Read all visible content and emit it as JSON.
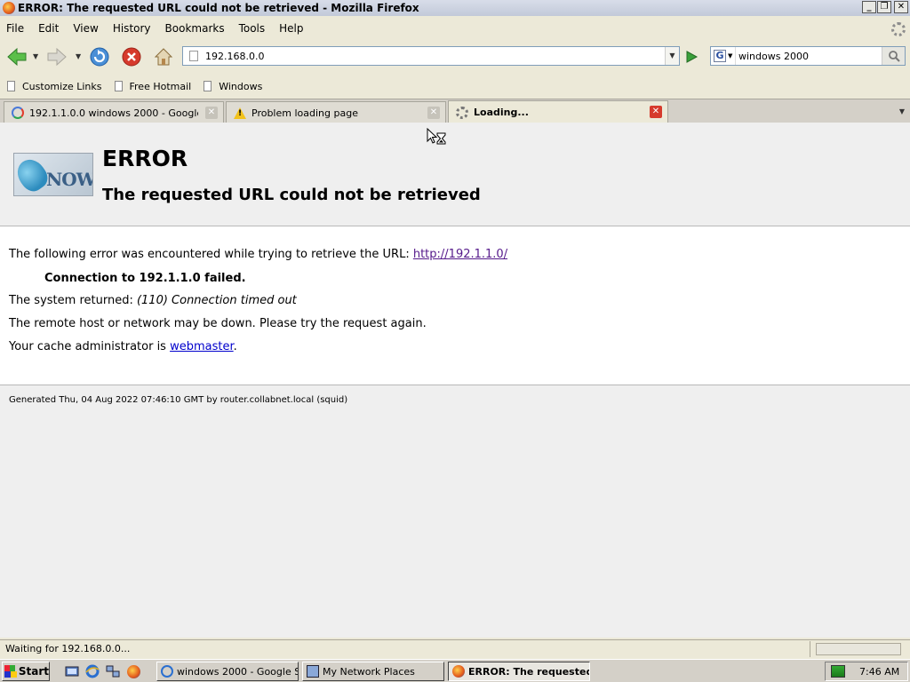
{
  "window": {
    "title": "ERROR: The requested URL could not be retrieved - Mozilla Firefox",
    "minimize": "_",
    "restore": "❐",
    "close": "✕"
  },
  "menu": [
    "File",
    "Edit",
    "View",
    "History",
    "Bookmarks",
    "Tools",
    "Help"
  ],
  "navbar": {
    "url": "192.168.0.0",
    "search_value": "windows 2000",
    "search_engine": "G"
  },
  "bookmarks": [
    "Customize Links",
    "Free Hotmail",
    "Windows"
  ],
  "tabs": [
    {
      "label": "192.1.1.0.0 windows 2000 - Google S...",
      "active": false
    },
    {
      "label": "Problem loading page",
      "active": false
    },
    {
      "label": "Loading...",
      "active": true
    }
  ],
  "page": {
    "logo_text": "NOW",
    "title": "ERROR",
    "subtitle": "The requested URL could not be retrieved",
    "line1_prefix": "The following error was encountered while trying to retrieve the URL: ",
    "line1_link": "http://192.1.1.0/",
    "fail_line": "Connection to 192.1.1.0 failed.",
    "line2_prefix": "The system returned: ",
    "line2_italic": "(110) Connection timed out",
    "line3": "The remote host or network may be down. Please try the request again.",
    "line4_prefix": "Your cache administrator is ",
    "line4_link": "webmaster",
    "line4_suffix": ".",
    "generated": "Generated Thu, 04 Aug 2022 07:46:10 GMT by router.collabnet.local (squid)"
  },
  "status": {
    "text": "Waiting for 192.168.0.0..."
  },
  "taskbar": {
    "start": "Start",
    "tasks": [
      {
        "label": "windows 2000 - Google S...",
        "active": false
      },
      {
        "label": "My Network Places",
        "active": false
      },
      {
        "label": "ERROR: The requested...",
        "active": true
      }
    ],
    "clock": "7:46 AM"
  },
  "colors": {
    "link_visited": "#551a8b",
    "link": "#0000cc",
    "stop_red": "#d63a2c",
    "nav_green": "#3aa03a"
  }
}
